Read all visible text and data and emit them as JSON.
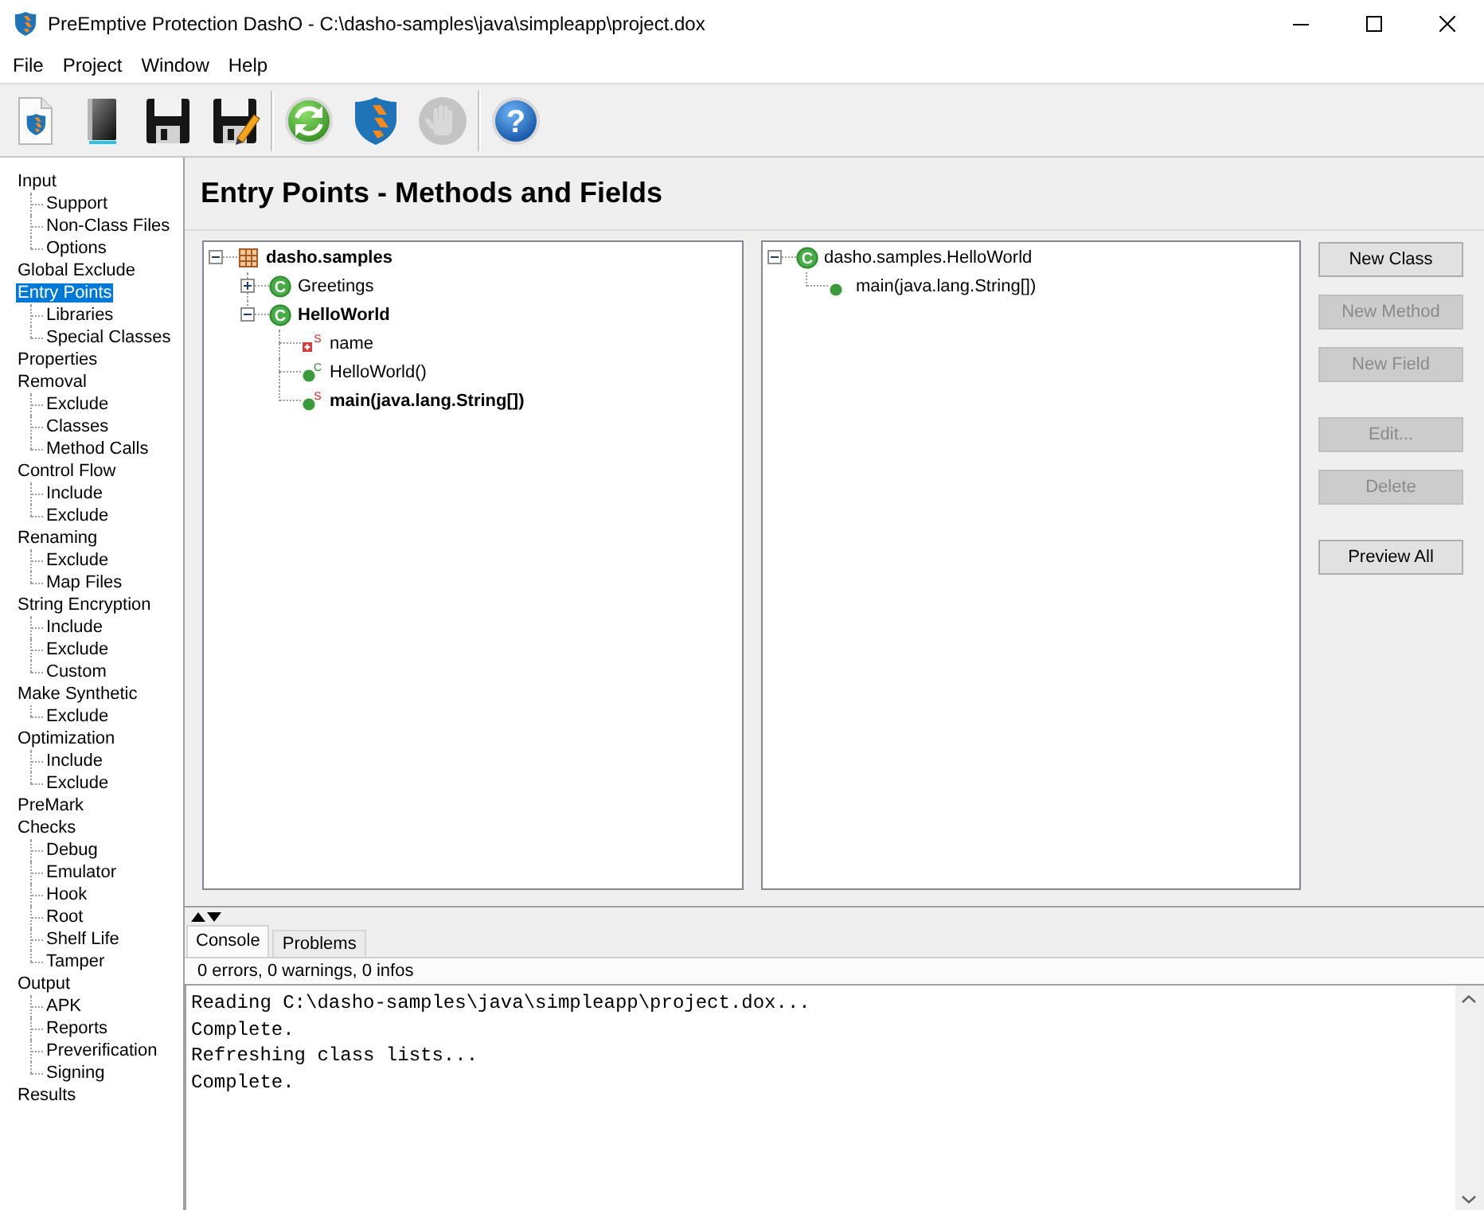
{
  "window": {
    "title": "PreEmptive Protection DashO - C:\\dasho-samples\\java\\simpleapp\\project.dox"
  },
  "menu": [
    "File",
    "Project",
    "Window",
    "Help"
  ],
  "toolbar": [
    {
      "buttons": [
        {
          "kind": "new_project",
          "disabled": false
        },
        {
          "kind": "open",
          "disabled": false
        },
        {
          "kind": "save",
          "disabled": false
        },
        {
          "kind": "save_as",
          "disabled": false
        }
      ]
    },
    {
      "buttons": [
        {
          "kind": "refresh",
          "disabled": false
        },
        {
          "kind": "protect",
          "disabled": false
        },
        {
          "kind": "stop",
          "disabled": true
        }
      ]
    },
    {
      "buttons": [
        {
          "kind": "help",
          "glyph": "?",
          "disabled": false
        }
      ]
    }
  ],
  "sidebar": {
    "items": [
      {
        "label": "Input",
        "selected": false,
        "children": [
          {
            "label": "Support",
            "selected": false
          },
          {
            "label": "Non-Class Files",
            "selected": false
          },
          {
            "label": "Options",
            "selected": false
          }
        ]
      },
      {
        "label": "Global Exclude",
        "selected": false
      },
      {
        "label": "Entry Points",
        "selected": true,
        "children": [
          {
            "label": "Libraries",
            "selected": false
          },
          {
            "label": "Special Classes",
            "selected": false
          }
        ]
      },
      {
        "label": "Properties",
        "selected": false
      },
      {
        "label": "Removal",
        "selected": false,
        "children": [
          {
            "label": "Exclude",
            "selected": false
          },
          {
            "label": "Classes",
            "selected": false
          },
          {
            "label": "Method Calls",
            "selected": false
          }
        ]
      },
      {
        "label": "Control Flow",
        "selected": false,
        "children": [
          {
            "label": "Include",
            "selected": false
          },
          {
            "label": "Exclude",
            "selected": false
          }
        ]
      },
      {
        "label": "Renaming",
        "selected": false,
        "children": [
          {
            "label": "Exclude",
            "selected": false
          },
          {
            "label": "Map Files",
            "selected": false
          }
        ]
      },
      {
        "label": "String Encryption",
        "selected": false,
        "children": [
          {
            "label": "Include",
            "selected": false
          },
          {
            "label": "Exclude",
            "selected": false
          },
          {
            "label": "Custom",
            "selected": false
          }
        ]
      },
      {
        "label": "Make Synthetic",
        "selected": false,
        "children": [
          {
            "label": "Exclude",
            "selected": false
          }
        ]
      },
      {
        "label": "Optimization",
        "selected": false,
        "children": [
          {
            "label": "Include",
            "selected": false
          },
          {
            "label": "Exclude",
            "selected": false
          }
        ]
      },
      {
        "label": "PreMark",
        "selected": false
      },
      {
        "label": "Checks",
        "selected": false,
        "children": [
          {
            "label": "Debug",
            "selected": false
          },
          {
            "label": "Emulator",
            "selected": false
          },
          {
            "label": "Hook",
            "selected": false
          },
          {
            "label": "Root",
            "selected": false
          },
          {
            "label": "Shelf Life",
            "selected": false
          },
          {
            "label": "Tamper",
            "selected": false
          }
        ]
      },
      {
        "label": "Output",
        "selected": false,
        "children": [
          {
            "label": "APK",
            "selected": false
          },
          {
            "label": "Reports",
            "selected": false
          },
          {
            "label": "Preverification",
            "selected": false
          },
          {
            "label": "Signing",
            "selected": false
          }
        ]
      },
      {
        "label": "Results",
        "selected": false
      }
    ]
  },
  "page": {
    "title": "Entry Points - Methods and Fields"
  },
  "class_tree": {
    "nodes": [
      {
        "label": "dasho.samples",
        "kind": "package",
        "expanded": true,
        "included": true,
        "children": [
          {
            "label": "Greetings",
            "kind": "class",
            "glyph": "C",
            "expanded": false,
            "included": false
          },
          {
            "label": "HelloWorld",
            "kind": "class",
            "glyph": "C",
            "expanded": true,
            "included": true,
            "children": [
              {
                "label": "name",
                "kind": "field",
                "badge": {
                  "text": "S",
                  "kind": "static"
                },
                "included": false
              },
              {
                "label": "HelloWorld()",
                "kind": "constructor",
                "badge": {
                  "text": "C",
                  "kind": "constructor"
                },
                "included": false
              },
              {
                "label": "main(java.lang.String[])",
                "kind": "method",
                "badge": {
                  "text": "S",
                  "kind": "static"
                },
                "included": true
              }
            ]
          }
        ]
      }
    ]
  },
  "entry_tree": {
    "nodes": [
      {
        "label": "dasho.samples.HelloWorld",
        "kind": "class",
        "glyph": "C",
        "expanded": true,
        "children": [
          {
            "label": "main(java.lang.String[])",
            "kind": "method"
          }
        ]
      }
    ]
  },
  "actions": [
    {
      "buttons": [
        {
          "label": "New Class",
          "disabled": false
        },
        {
          "label": "New Method",
          "disabled": true
        },
        {
          "label": "New Field",
          "disabled": true
        }
      ]
    },
    {
      "buttons": [
        {
          "label": "Edit...",
          "disabled": true
        },
        {
          "label": "Delete",
          "disabled": true
        }
      ]
    },
    {
      "buttons": [
        {
          "label": "Preview All",
          "disabled": false
        }
      ]
    }
  ],
  "output": {
    "tabs": [
      {
        "label": "Console",
        "selected": true
      },
      {
        "label": "Problems",
        "selected": false
      }
    ],
    "status": "0 errors, 0 warnings, 0 infos",
    "lines": [
      "Reading C:\\dasho-samples\\java\\simpleapp\\project.dox...",
      "Complete.",
      "Refreshing class lists...",
      "Complete."
    ]
  }
}
